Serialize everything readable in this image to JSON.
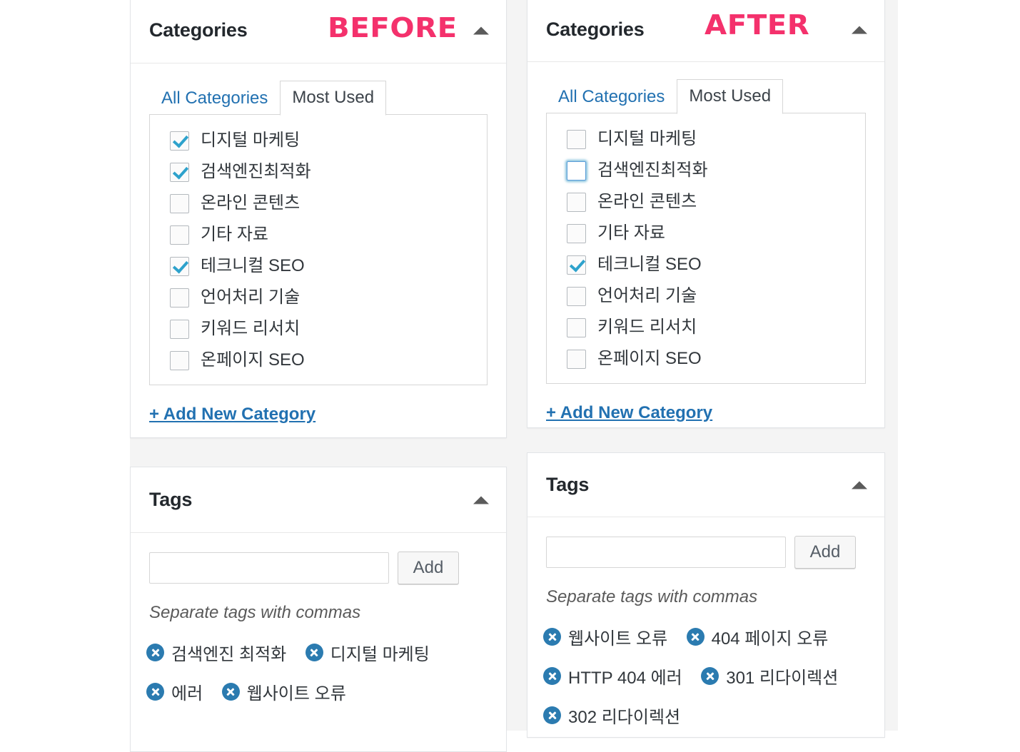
{
  "stamps": {
    "before": "BEFORE",
    "after": "AFTER",
    "color": "#f4316c"
  },
  "accent_colors": {
    "link": "#2271b1",
    "checkmark": "#2ea2cc",
    "tag_remove": "#2b7bb0",
    "focus_ring": "#5b9dd9"
  },
  "before": {
    "categories": {
      "title": "Categories",
      "tabs": [
        {
          "label": "All Categories",
          "active": false
        },
        {
          "label": "Most Used",
          "active": true
        }
      ],
      "items": [
        {
          "label": "디지털 마케팅",
          "checked": true,
          "focused": false
        },
        {
          "label": "검색엔진최적화",
          "checked": true,
          "focused": false
        },
        {
          "label": "온라인 콘텐츠",
          "checked": false,
          "focused": false
        },
        {
          "label": "기타 자료",
          "checked": false,
          "focused": false
        },
        {
          "label": "테크니컬 SEO",
          "checked": true,
          "focused": false
        },
        {
          "label": "언어처리 기술",
          "checked": false,
          "focused": false
        },
        {
          "label": "키워드 리서치",
          "checked": false,
          "focused": false
        },
        {
          "label": "온페이지 SEO",
          "checked": false,
          "focused": false
        }
      ],
      "add_link": "+ Add New Category"
    },
    "tags": {
      "title": "Tags",
      "input_value": "",
      "input_placeholder": "",
      "add_label": "Add",
      "hint": "Separate tags with commas",
      "chips": [
        "검색엔진 최적화",
        "디지털 마케팅",
        "에러",
        "웹사이트 오류"
      ]
    }
  },
  "after": {
    "categories": {
      "title": "Categories",
      "tabs": [
        {
          "label": "All Categories",
          "active": false
        },
        {
          "label": "Most Used",
          "active": true
        }
      ],
      "items": [
        {
          "label": "디지털 마케팅",
          "checked": false,
          "focused": false
        },
        {
          "label": "검색엔진최적화",
          "checked": false,
          "focused": true
        },
        {
          "label": "온라인 콘텐츠",
          "checked": false,
          "focused": false
        },
        {
          "label": "기타 자료",
          "checked": false,
          "focused": false
        },
        {
          "label": "테크니컬 SEO",
          "checked": true,
          "focused": false
        },
        {
          "label": "언어처리 기술",
          "checked": false,
          "focused": false
        },
        {
          "label": "키워드 리서치",
          "checked": false,
          "focused": false
        },
        {
          "label": "온페이지 SEO",
          "checked": false,
          "focused": false
        }
      ],
      "add_link": "+ Add New Category"
    },
    "tags": {
      "title": "Tags",
      "input_value": "",
      "input_placeholder": "",
      "add_label": "Add",
      "hint": "Separate tags with commas",
      "chips": [
        "웹사이트 오류",
        "404 페이지 오류",
        "HTTP 404 에러",
        "301 리다이렉션",
        "302 리다이렉션"
      ]
    }
  }
}
